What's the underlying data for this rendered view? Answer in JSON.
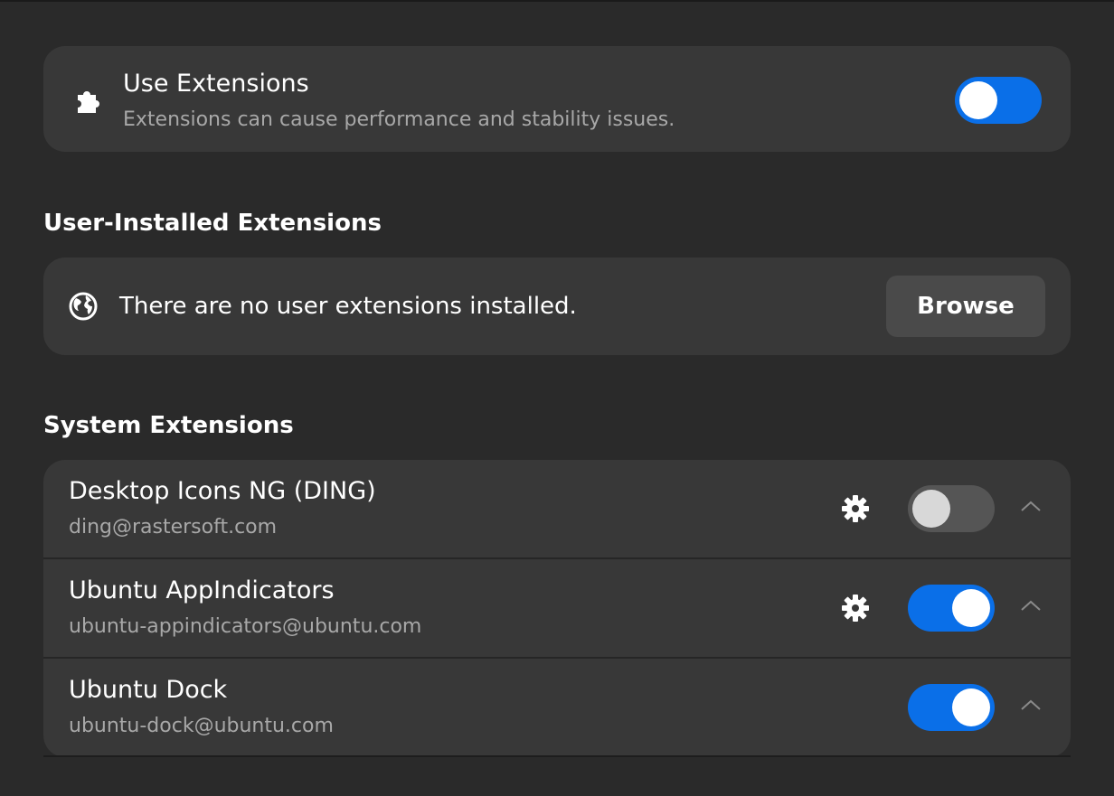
{
  "use_extensions": {
    "title": "Use Extensions",
    "subtitle": "Extensions can cause performance and stability issues.",
    "toggle_state": "on",
    "icon": "puzzle-icon"
  },
  "user_installed": {
    "heading": "User-Installed Extensions",
    "empty_message": "There are no user extensions installed.",
    "browse_label": "Browse",
    "icon": "globe-icon"
  },
  "system_extensions": {
    "heading": "System Extensions",
    "items": [
      {
        "name": "Desktop Icons NG (DING)",
        "id": "ding@rastersoft.com",
        "has_settings": true,
        "enabled": false
      },
      {
        "name": "Ubuntu AppIndicators",
        "id": "ubuntu-appindicators@ubuntu.com",
        "has_settings": true,
        "enabled": true
      },
      {
        "name": "Ubuntu Dock",
        "id": "ubuntu-dock@ubuntu.com",
        "has_settings": false,
        "enabled": true
      }
    ]
  },
  "colors": {
    "accent": "#0a6fe8",
    "card": "#383838",
    "background": "#2a2a2a",
    "secondary_text": "#a8a8a8"
  }
}
